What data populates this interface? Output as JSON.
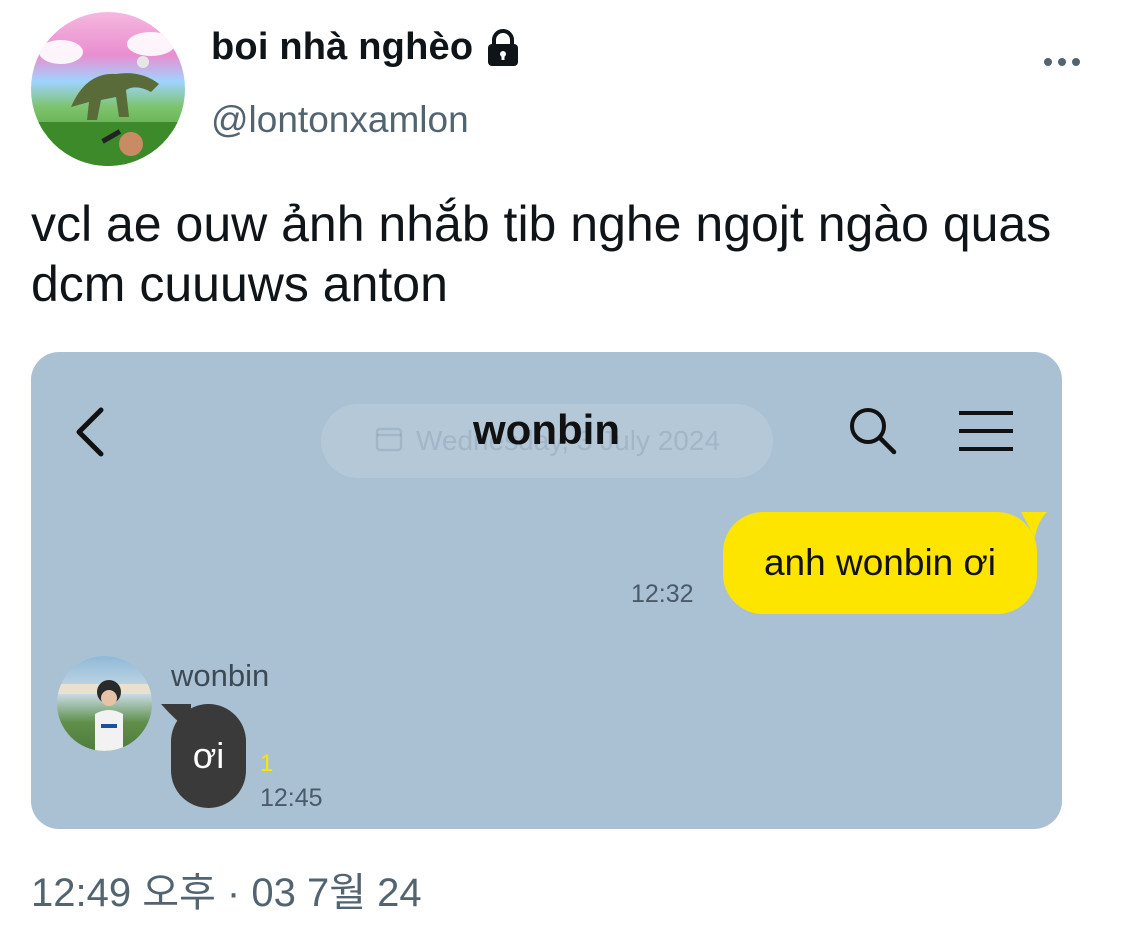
{
  "tweet": {
    "display_name": "boi nhà nghèo",
    "handle": "@lontonxamlon",
    "text": "vcl ae ouw ảnh nhắb tib nghe ngojt ngào quas dcm cuuuws anton",
    "timestamp": "12:49 오후 · 03 7월 24",
    "icons": {
      "protected": "lock-icon",
      "more": "more-options-icon"
    }
  },
  "chat": {
    "title": "wonbin",
    "date_banner": "Wednesday, 3 July 2024",
    "outgoing": {
      "text": "anh wonbin ơi",
      "time": "12:32"
    },
    "incoming": {
      "sender": "wonbin",
      "text": "ơi",
      "unread": "1",
      "time": "12:45"
    },
    "colors": {
      "background": "#aac1d3",
      "outgoing_bubble": "#fee500",
      "incoming_bubble": "#3a3a3a"
    },
    "icons": {
      "back": "back-arrow-icon",
      "search": "search-icon",
      "menu": "hamburger-menu-icon"
    }
  }
}
